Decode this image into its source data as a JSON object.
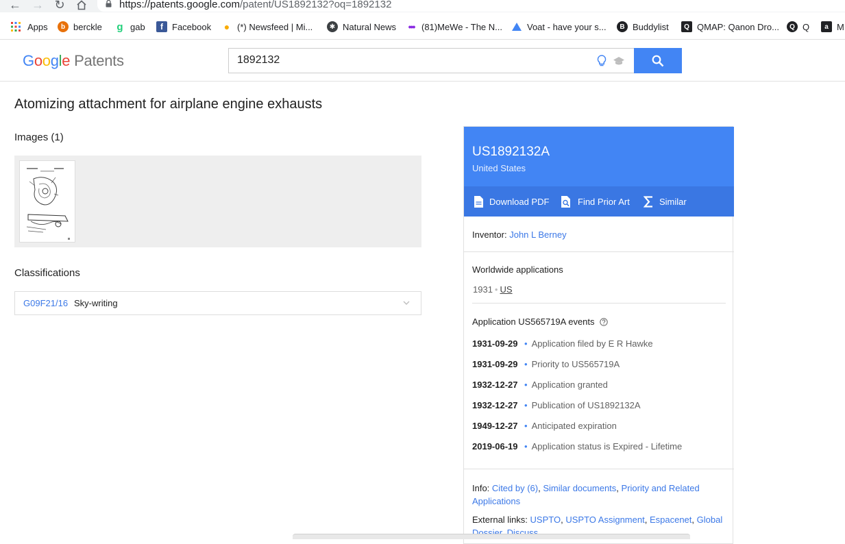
{
  "browser": {
    "url_host": "https://patents.google.com",
    "url_path": "/patent/US1892132?oq=1892132",
    "bookmarks": [
      {
        "label": "Apps"
      },
      {
        "label": "berckle"
      },
      {
        "label": "gab"
      },
      {
        "label": "Facebook"
      },
      {
        "label": "(*) Newsfeed | Mi..."
      },
      {
        "label": "Natural News"
      },
      {
        "label": "(81)MeWe - The N..."
      },
      {
        "label": "Voat - have your s..."
      },
      {
        "label": "Buddylist"
      },
      {
        "label": "QMAP: Qanon Dro..."
      },
      {
        "label": "Q"
      },
      {
        "label": "M"
      }
    ]
  },
  "header": {
    "logo_google": "Google",
    "logo_patents": "Patents",
    "search_value": "1892132"
  },
  "patent": {
    "title": "Atomizing attachment for airplane engine exhausts",
    "images_heading": "Images (1)",
    "classifications_heading": "Classifications",
    "classification_code": "G09F21/16",
    "classification_desc": "Sky-writing",
    "pub_number": "US1892132A",
    "country": "United States",
    "actions": {
      "download": "Download PDF",
      "prior_art": "Find Prior Art",
      "similar": "Similar"
    },
    "inventor_label": "Inventor:",
    "inventor": "John L Berney",
    "worldwide_heading": "Worldwide applications",
    "ww_year": "1931",
    "ww_country": "US",
    "events_heading": "Application US565719A events",
    "events": [
      {
        "date": "1931-09-29",
        "text": "Application filed by E R Hawke"
      },
      {
        "date": "1931-09-29",
        "text": "Priority to US565719A"
      },
      {
        "date": "1932-12-27",
        "text": "Application granted"
      },
      {
        "date": "1932-12-27",
        "text": "Publication of US1892132A"
      },
      {
        "date": "1949-12-27",
        "text": "Anticipated expiration"
      },
      {
        "date": "2019-06-19",
        "text": "Application status is Expired - Lifetime"
      }
    ],
    "info_label": "Info:",
    "info_links": [
      "Cited by (6)",
      "Similar documents",
      "Priority and Related Applications"
    ],
    "ext_label": "External links:",
    "ext_links": [
      "USPTO",
      "USPTO Assignment",
      "Espacenet",
      "Global Dossier",
      "Discuss"
    ]
  }
}
